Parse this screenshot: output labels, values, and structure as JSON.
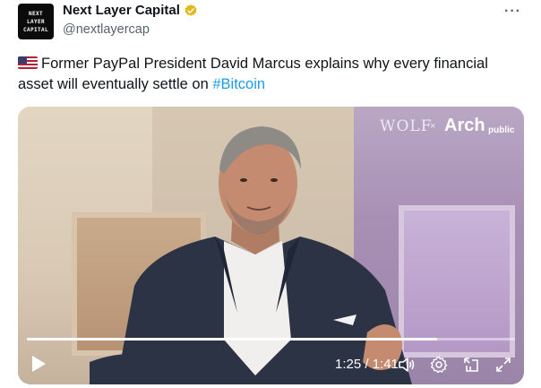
{
  "tweet": {
    "author_name": "Next Layer Capital",
    "handle": "@nextlayercap",
    "avatar_lines": [
      "NEXT",
      "LAYER",
      "CAPITAL"
    ],
    "more_label": "···",
    "text_before": "Former PayPal President David Marcus explains why every financial asset will eventually settle on ",
    "hashtag": "#Bitcoin",
    "flag_icon": "us-flag-icon"
  },
  "video": {
    "watermark_wolf": "WOLF",
    "watermark_x": "×",
    "watermark_arch": "Arch",
    "watermark_public": "public",
    "time_display": "1:25 / 1:41",
    "progress_fraction": 0.84
  },
  "colors": {
    "text": "#0f1419",
    "secondary": "#536471",
    "link": "#1d9bf0",
    "verified": "#e2b719"
  }
}
